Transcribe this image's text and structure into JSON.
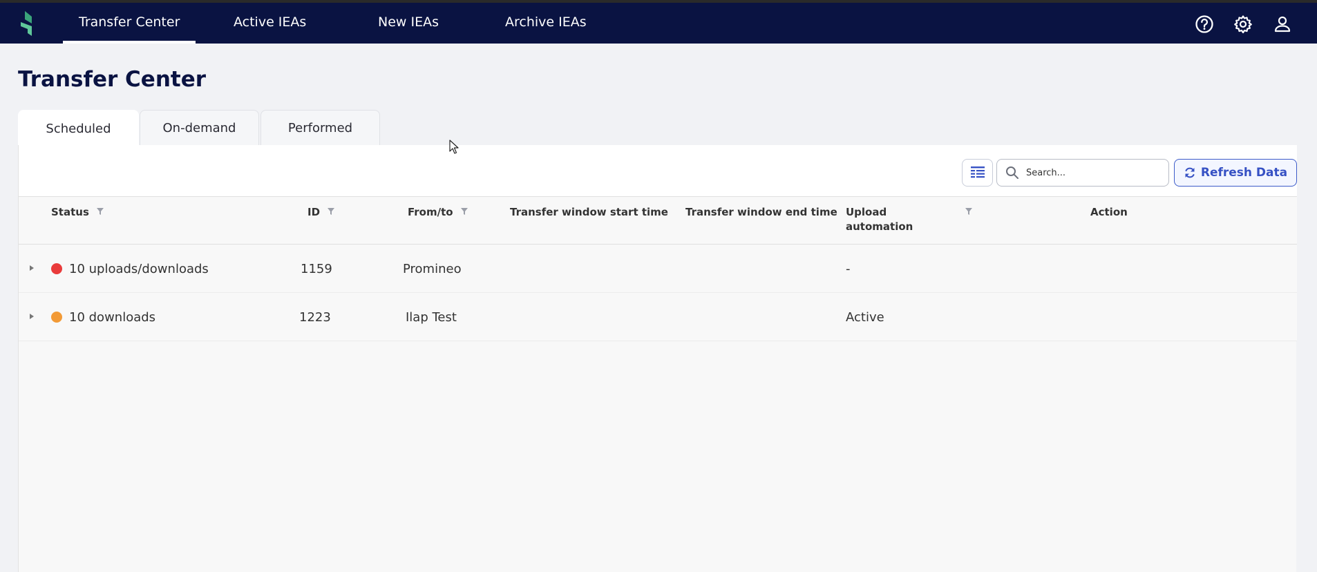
{
  "nav": {
    "tabs": [
      {
        "label": "Transfer Center",
        "active": true
      },
      {
        "label": "Active IEAs",
        "active": false
      },
      {
        "label": "New IEAs",
        "active": false
      },
      {
        "label": "Archive IEAs",
        "active": false
      }
    ],
    "icons": [
      "help-icon",
      "gear-icon",
      "user-icon"
    ]
  },
  "page": {
    "title": "Transfer Center"
  },
  "subtabs": [
    {
      "label": "Scheduled",
      "active": true
    },
    {
      "label": "On-demand",
      "active": false
    },
    {
      "label": "Performed",
      "active": false
    }
  ],
  "toolbar": {
    "search_placeholder": "Search...",
    "refresh_label": "Refresh Data"
  },
  "table": {
    "columns": [
      "Status",
      "ID",
      "From/to",
      "Transfer window start time",
      "Transfer window end time",
      "Upload automation",
      "Action"
    ],
    "rows": [
      {
        "status": "10 uploads/downloads",
        "status_color": "#e93b3b",
        "id": "1159",
        "from_to": "Promineo",
        "start": "",
        "end": "",
        "upload_automation": "-",
        "action": ""
      },
      {
        "status": "10 downloads",
        "status_color": "#f29a36",
        "id": "1223",
        "from_to": "Ilap Test",
        "start": "",
        "end": "",
        "upload_automation": "Active",
        "action": ""
      }
    ]
  },
  "colors": {
    "nav_bg": "#0a1342",
    "accent": "#3651c4"
  }
}
